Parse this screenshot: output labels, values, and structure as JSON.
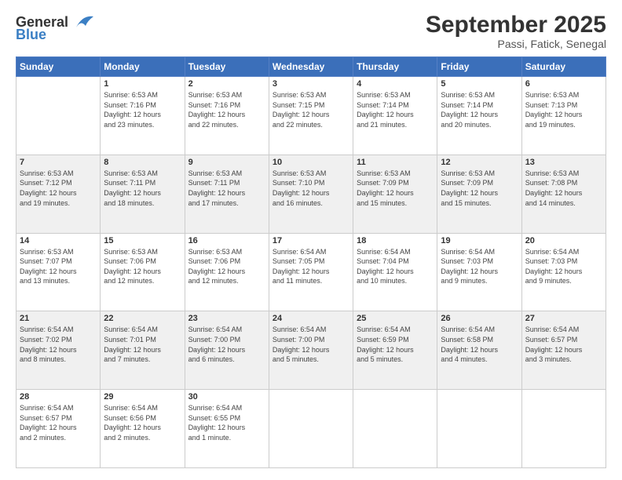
{
  "header": {
    "logo_line1": "General",
    "logo_line2": "Blue",
    "title": "September 2025",
    "subtitle": "Passi, Fatick, Senegal"
  },
  "calendar": {
    "days": [
      "Sunday",
      "Monday",
      "Tuesday",
      "Wednesday",
      "Thursday",
      "Friday",
      "Saturday"
    ],
    "weeks": [
      [
        {
          "date": "",
          "info": ""
        },
        {
          "date": "1",
          "info": "Sunrise: 6:53 AM\nSunset: 7:16 PM\nDaylight: 12 hours\nand 23 minutes."
        },
        {
          "date": "2",
          "info": "Sunrise: 6:53 AM\nSunset: 7:16 PM\nDaylight: 12 hours\nand 22 minutes."
        },
        {
          "date": "3",
          "info": "Sunrise: 6:53 AM\nSunset: 7:15 PM\nDaylight: 12 hours\nand 22 minutes."
        },
        {
          "date": "4",
          "info": "Sunrise: 6:53 AM\nSunset: 7:14 PM\nDaylight: 12 hours\nand 21 minutes."
        },
        {
          "date": "5",
          "info": "Sunrise: 6:53 AM\nSunset: 7:14 PM\nDaylight: 12 hours\nand 20 minutes."
        },
        {
          "date": "6",
          "info": "Sunrise: 6:53 AM\nSunset: 7:13 PM\nDaylight: 12 hours\nand 19 minutes."
        }
      ],
      [
        {
          "date": "7",
          "info": "Sunrise: 6:53 AM\nSunset: 7:12 PM\nDaylight: 12 hours\nand 19 minutes."
        },
        {
          "date": "8",
          "info": "Sunrise: 6:53 AM\nSunset: 7:11 PM\nDaylight: 12 hours\nand 18 minutes."
        },
        {
          "date": "9",
          "info": "Sunrise: 6:53 AM\nSunset: 7:11 PM\nDaylight: 12 hours\nand 17 minutes."
        },
        {
          "date": "10",
          "info": "Sunrise: 6:53 AM\nSunset: 7:10 PM\nDaylight: 12 hours\nand 16 minutes."
        },
        {
          "date": "11",
          "info": "Sunrise: 6:53 AM\nSunset: 7:09 PM\nDaylight: 12 hours\nand 15 minutes."
        },
        {
          "date": "12",
          "info": "Sunrise: 6:53 AM\nSunset: 7:09 PM\nDaylight: 12 hours\nand 15 minutes."
        },
        {
          "date": "13",
          "info": "Sunrise: 6:53 AM\nSunset: 7:08 PM\nDaylight: 12 hours\nand 14 minutes."
        }
      ],
      [
        {
          "date": "14",
          "info": "Sunrise: 6:53 AM\nSunset: 7:07 PM\nDaylight: 12 hours\nand 13 minutes."
        },
        {
          "date": "15",
          "info": "Sunrise: 6:53 AM\nSunset: 7:06 PM\nDaylight: 12 hours\nand 12 minutes."
        },
        {
          "date": "16",
          "info": "Sunrise: 6:53 AM\nSunset: 7:06 PM\nDaylight: 12 hours\nand 12 minutes."
        },
        {
          "date": "17",
          "info": "Sunrise: 6:54 AM\nSunset: 7:05 PM\nDaylight: 12 hours\nand 11 minutes."
        },
        {
          "date": "18",
          "info": "Sunrise: 6:54 AM\nSunset: 7:04 PM\nDaylight: 12 hours\nand 10 minutes."
        },
        {
          "date": "19",
          "info": "Sunrise: 6:54 AM\nSunset: 7:03 PM\nDaylight: 12 hours\nand 9 minutes."
        },
        {
          "date": "20",
          "info": "Sunrise: 6:54 AM\nSunset: 7:03 PM\nDaylight: 12 hours\nand 9 minutes."
        }
      ],
      [
        {
          "date": "21",
          "info": "Sunrise: 6:54 AM\nSunset: 7:02 PM\nDaylight: 12 hours\nand 8 minutes."
        },
        {
          "date": "22",
          "info": "Sunrise: 6:54 AM\nSunset: 7:01 PM\nDaylight: 12 hours\nand 7 minutes."
        },
        {
          "date": "23",
          "info": "Sunrise: 6:54 AM\nSunset: 7:00 PM\nDaylight: 12 hours\nand 6 minutes."
        },
        {
          "date": "24",
          "info": "Sunrise: 6:54 AM\nSunset: 7:00 PM\nDaylight: 12 hours\nand 5 minutes."
        },
        {
          "date": "25",
          "info": "Sunrise: 6:54 AM\nSunset: 6:59 PM\nDaylight: 12 hours\nand 5 minutes."
        },
        {
          "date": "26",
          "info": "Sunrise: 6:54 AM\nSunset: 6:58 PM\nDaylight: 12 hours\nand 4 minutes."
        },
        {
          "date": "27",
          "info": "Sunrise: 6:54 AM\nSunset: 6:57 PM\nDaylight: 12 hours\nand 3 minutes."
        }
      ],
      [
        {
          "date": "28",
          "info": "Sunrise: 6:54 AM\nSunset: 6:57 PM\nDaylight: 12 hours\nand 2 minutes."
        },
        {
          "date": "29",
          "info": "Sunrise: 6:54 AM\nSunset: 6:56 PM\nDaylight: 12 hours\nand 2 minutes."
        },
        {
          "date": "30",
          "info": "Sunrise: 6:54 AM\nSunset: 6:55 PM\nDaylight: 12 hours\nand 1 minute."
        },
        {
          "date": "",
          "info": ""
        },
        {
          "date": "",
          "info": ""
        },
        {
          "date": "",
          "info": ""
        },
        {
          "date": "",
          "info": ""
        }
      ]
    ]
  }
}
